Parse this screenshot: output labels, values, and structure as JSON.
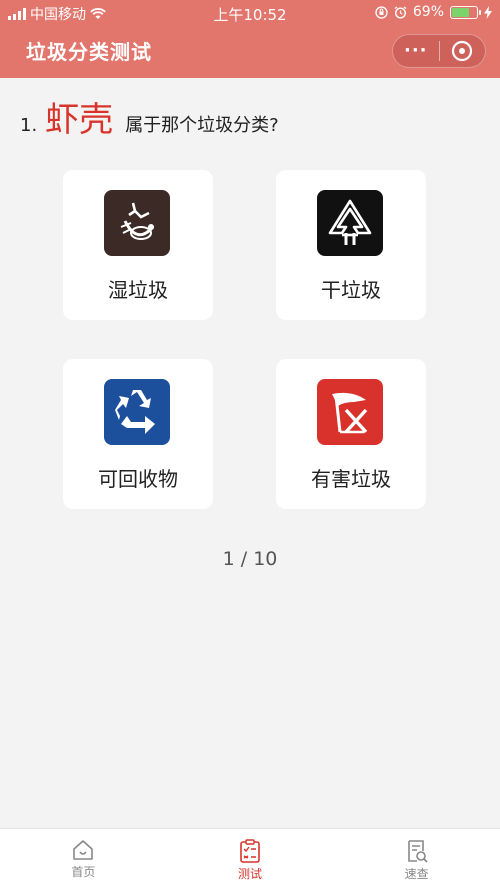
{
  "status_bar": {
    "carrier": "中国移动",
    "time": "上午10:52",
    "battery": "69%",
    "battery_level": 0.69
  },
  "nav": {
    "title": "垃圾分类测试",
    "more": "···"
  },
  "question": {
    "number": "1.",
    "item": "虾壳",
    "text": "属于那个垃圾分类?"
  },
  "options": [
    {
      "label": "湿垃圾",
      "icon": "wet-waste-icon",
      "color": "#3c2a26"
    },
    {
      "label": "干垃圾",
      "icon": "dry-waste-icon",
      "color": "#111111"
    },
    {
      "label": "可回收物",
      "icon": "recycle-icon",
      "color": "#1c4f9c"
    },
    {
      "label": "有害垃圾",
      "icon": "hazardous-waste-icon",
      "color": "#d9312b"
    }
  ],
  "progress": "1 / 10",
  "tabbar": {
    "items": [
      {
        "label": "首页",
        "icon": "home-icon"
      },
      {
        "label": "测试",
        "icon": "test-clipboard-icon",
        "active": true
      },
      {
        "label": "速查",
        "icon": "quick-search-icon"
      }
    ]
  },
  "colors": {
    "accent": "#e2766d",
    "highlight": "#d9342b"
  }
}
